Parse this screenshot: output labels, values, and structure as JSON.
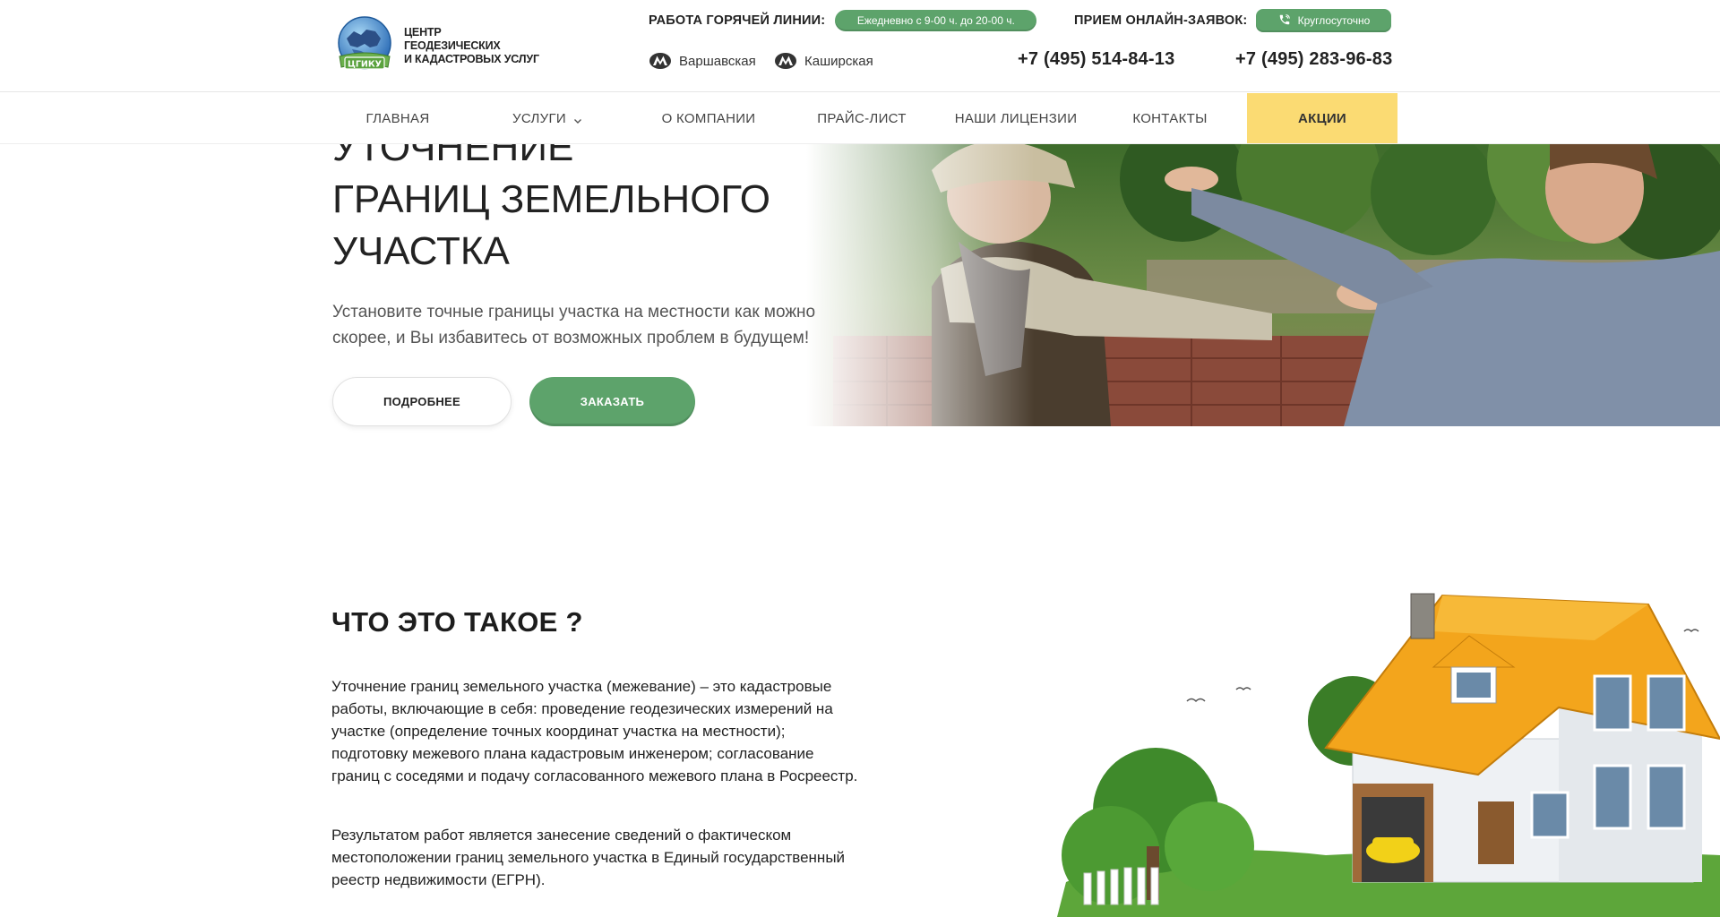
{
  "header": {
    "logo": {
      "badge": "ЦГИКУ",
      "line1": "ЦЕНТР ГЕОДЕЗИЧЕСКИХ",
      "line2": "И КАДАСТРОВЫХ УСЛУГ"
    },
    "hotline_label": "РАБОТА ГОРЯЧЕЙ ЛИНИИ:",
    "hotline_hours": "Ежедневно с 9-00 ч. до 20-00 ч.",
    "online_label": "ПРИЕМ ОНЛАЙН-ЗАЯВОК:",
    "online_hours": "Круглосуточно",
    "metro": [
      "Варшавская",
      "Каширская"
    ],
    "phones": [
      "+7 (495) 514-84-13",
      "+7 (495) 283-96-83"
    ]
  },
  "nav": {
    "items": [
      "ГЛАВНАЯ",
      "УСЛУГИ",
      "О КОМПАНИИ",
      "ПРАЙС-ЛИСТ",
      "НАШИ ЛИЦЕНЗИИ",
      "КОНТАКТЫ",
      "АКЦИИ"
    ]
  },
  "hero": {
    "title_lines": [
      "УТОЧНЕНИЕ",
      "ГРАНИЦ ЗЕМЕЛЬНОГО",
      "УЧАСТКА"
    ],
    "subtitle": "Установите точные границы участка на местности как можно скорее, и Вы избавитесь от возможных проблем в будущем!",
    "btn_more": "ПОДРОБНЕЕ",
    "btn_order": "ЗАКАЗАТЬ"
  },
  "about": {
    "title": "ЧТО ЭТО ТАКОЕ ?",
    "p1": "Уточнение границ земельного участка (межевание) – это кадастровые работы, включающие в себя: проведение геодезических измерений на участке (определение точных координат участка на местности); подготовку межевого плана кадастровым инженером; согласование границ с соседями и подачу согласованного межевого плана в Росреестр.",
    "p2": "Результатом работ является занесение сведений о фактическом местоположении границ земельного участка в Единый государственный реестр недвижимости (ЕГРН)."
  },
  "colors": {
    "accent_green": "#5da36b",
    "promo_yellow": "#fbdb73",
    "roof_orange": "#f3a51c"
  },
  "icons": [
    "globe-logo-icon",
    "metro-icon",
    "phone-icon",
    "chevron-down-icon"
  ]
}
